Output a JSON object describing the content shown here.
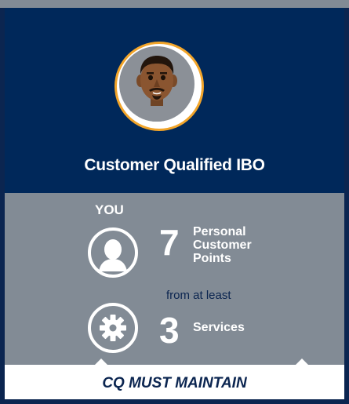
{
  "card": {
    "title": "Customer Qualified IBO",
    "you_label": "YOU",
    "points": {
      "number": "7",
      "label_lines": [
        "Personal",
        "Customer",
        "Points"
      ]
    },
    "connector": "from at least",
    "services": {
      "number": "3",
      "label": "Services"
    },
    "footer": "CQ MUST MAINTAIN"
  },
  "colors": {
    "navy": "#00285a",
    "dark_navy": "#0b2550",
    "gray": "#828b95",
    "gold_ring": "#f2a52a",
    "white": "#ffffff"
  },
  "icons": [
    "man-avatar-icon",
    "person-head-icon",
    "gear-icon"
  ]
}
